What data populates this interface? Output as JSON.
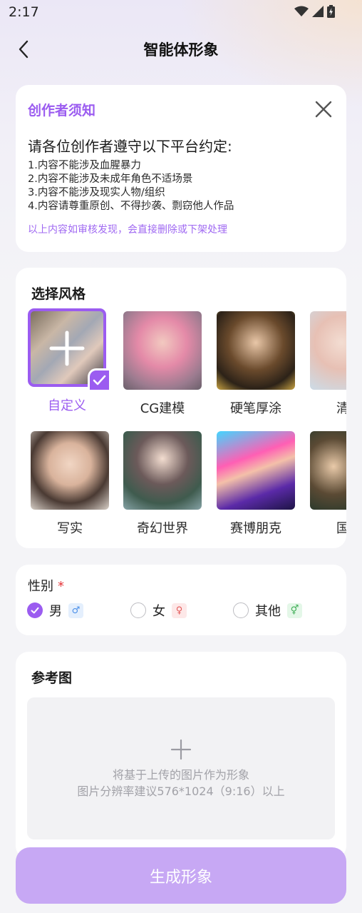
{
  "status_bar": {
    "time": "2:17"
  },
  "header": {
    "title": "智能体形象"
  },
  "notice": {
    "title": "创作者须知",
    "lead": "请各位创作者遵守以下平台约定:",
    "rules": [
      "1.内容不能涉及血腥暴力",
      "2.内容不能涉及未成年角色不适场景",
      "3.内容不能涉及现实人物/组织",
      "4.内容请尊重原创、不得抄袭、剽窃他人作品"
    ],
    "warning": "以上内容如审核发现，会直接删除或下架处理"
  },
  "styles": {
    "title": "选择风格",
    "items": [
      {
        "label": "自定义",
        "selected": true
      },
      {
        "label": "CG建模",
        "selected": false
      },
      {
        "label": "硬笔厚涂",
        "selected": false
      },
      {
        "label": "清新",
        "selected": false
      },
      {
        "label": "写实",
        "selected": false
      },
      {
        "label": "奇幻世界",
        "selected": false
      },
      {
        "label": "赛博朋克",
        "selected": false
      },
      {
        "label": "国风",
        "selected": false
      }
    ]
  },
  "gender": {
    "label": "性别",
    "required_mark": "*",
    "options": [
      {
        "label": "男",
        "symbol": "♂",
        "checked": true
      },
      {
        "label": "女",
        "symbol": "♀",
        "checked": false
      },
      {
        "label": "其他",
        "symbol": "⚥",
        "checked": false
      }
    ]
  },
  "reference": {
    "title": "参考图",
    "hint_line1": "将基于上传的图片作为形象",
    "hint_line2": "图片分辨率建议576*1024（9:16）以上"
  },
  "generate_button": {
    "label": "生成形象"
  },
  "colors": {
    "accent": "#9b5cf0",
    "button_disabled": "#c7a8f4",
    "required": "#e5363a"
  }
}
